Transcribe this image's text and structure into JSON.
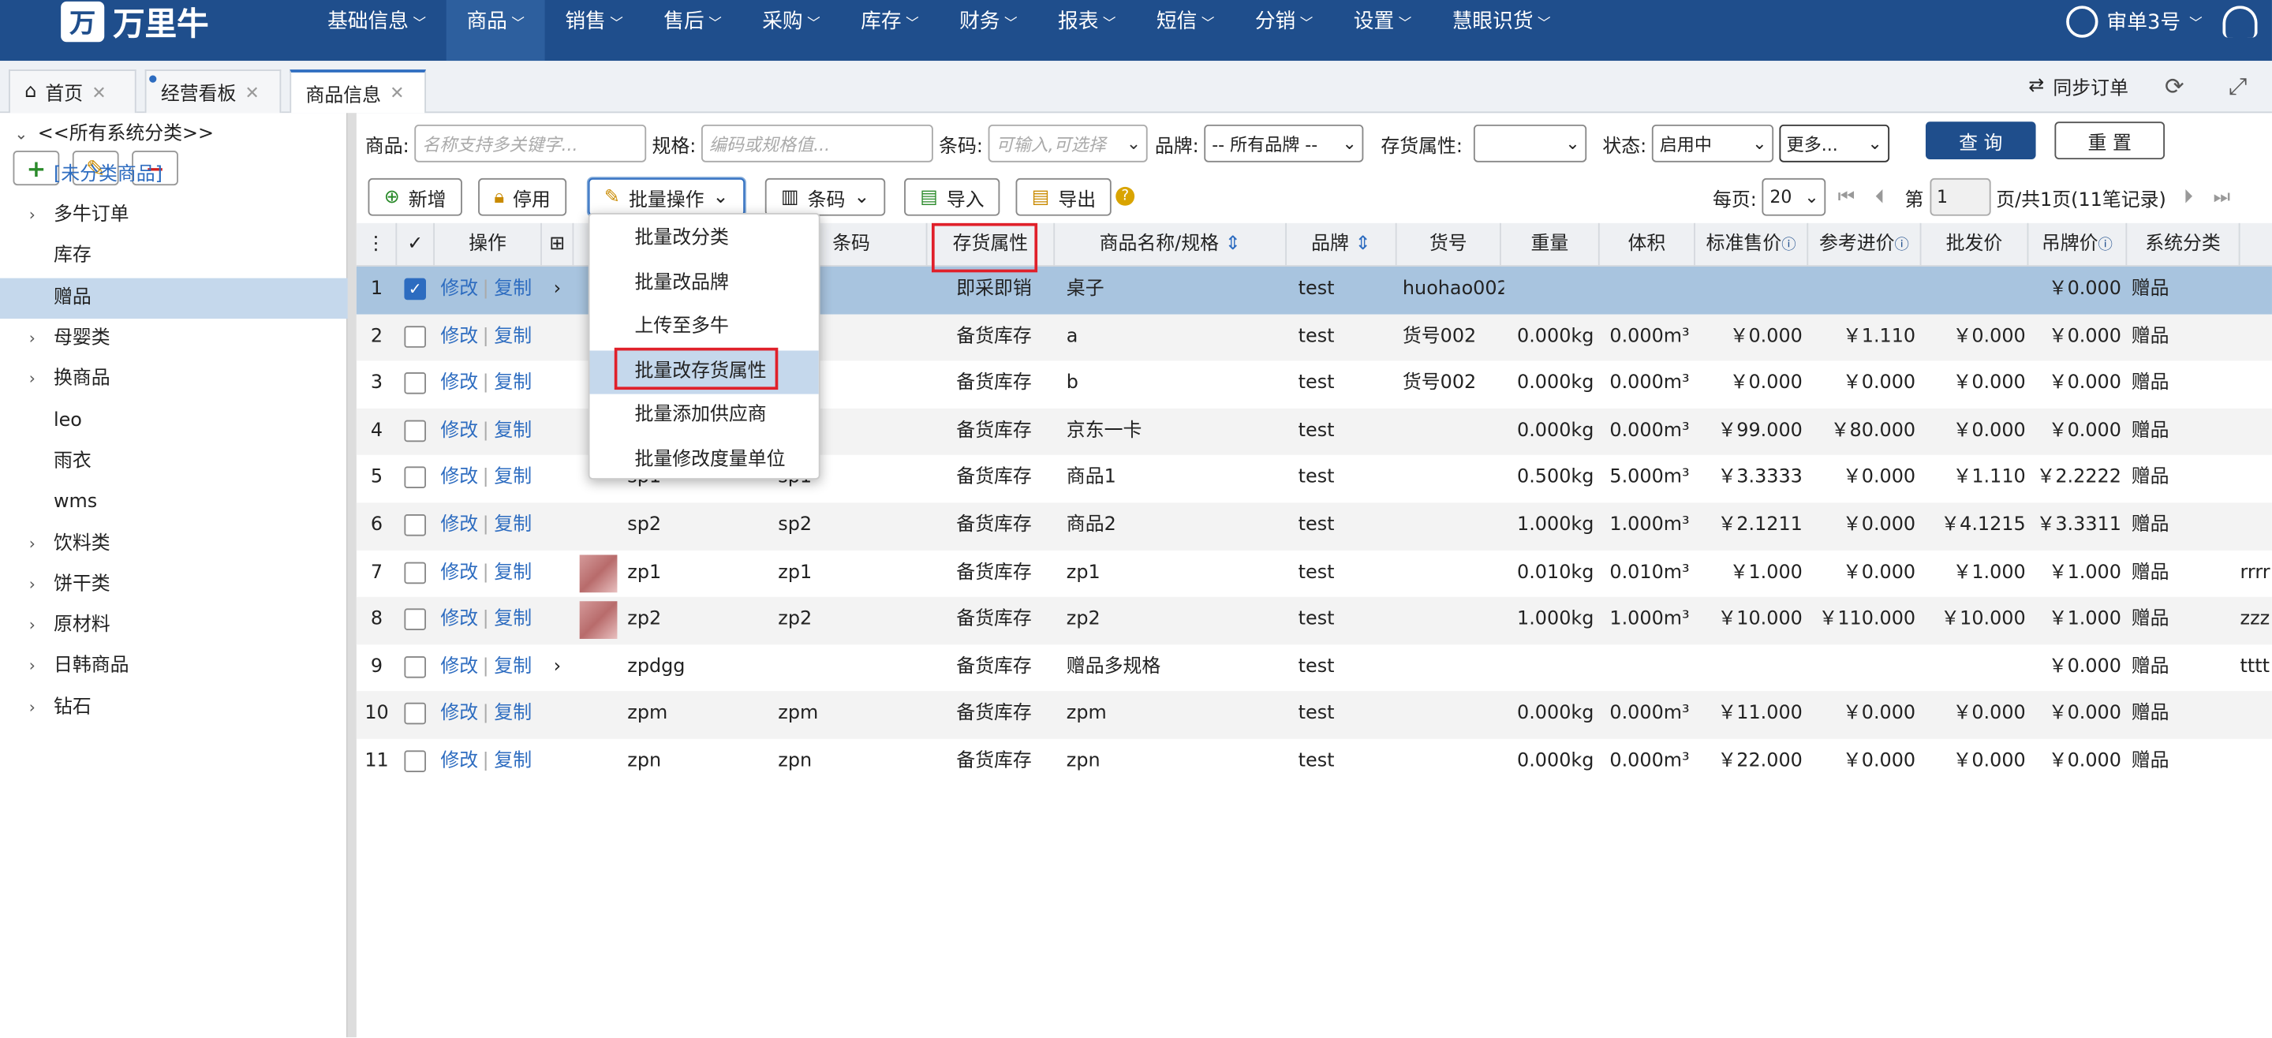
{
  "brand": {
    "logo_mark": "万",
    "name": "万里牛"
  },
  "nav": [
    "基础信息",
    "商品",
    "销售",
    "售后",
    "采购",
    "库存",
    "财务",
    "报表",
    "短信",
    "分销",
    "设置",
    "慧眼识货"
  ],
  "user": {
    "name": "审单3号"
  },
  "tabs": [
    {
      "label": "首页"
    },
    {
      "label": "经营看板"
    },
    {
      "label": "商品信息"
    }
  ],
  "tab_tools": {
    "sync_label": "同步订单"
  },
  "sidebar": {
    "buttons": [
      "+",
      "✎",
      "−"
    ],
    "items": [
      "<<所有系统分类>>",
      "[未分类商品]",
      "多牛订单",
      "库存",
      "赠品",
      "母婴类",
      "换商品",
      "leo",
      "雨衣",
      "wms",
      "饮料类",
      "饼干类",
      "原材料",
      "日韩商品",
      "钻石"
    ]
  },
  "filters": {
    "product_label": "商品:",
    "product_placeholder": "名称支持多关键字...",
    "spec_label": "规格:",
    "spec_placeholder": "编码或规格值...",
    "barcode_label": "条码:",
    "barcode_placeholder": "可输入,可选择",
    "brand_label": "品牌:",
    "brand_value": "-- 所有品牌 --",
    "stock_attr_label": "存货属性:",
    "stock_attr_value": "",
    "status_label": "状态:",
    "status_value": "启用中",
    "more_label": "更多...",
    "query_label": "查 询",
    "reset_label": "重 置"
  },
  "toolbar": {
    "add": "新增",
    "disable": "停用",
    "batch": "批量操作",
    "barcode": "条码",
    "import": "导入",
    "export": "导出"
  },
  "pager": {
    "per_page_label": "每页:",
    "per_page": "20",
    "page_prefix": "第",
    "page_value": "1",
    "page_suffix": "页/共1页(11笔记录)"
  },
  "columns": [
    "操作",
    "条码",
    "存货属性",
    "商品名称/规格",
    "品牌",
    "货号",
    "重量",
    "体积",
    "标准售价",
    "参考进价",
    "批发价",
    "吊牌价",
    "系统分类"
  ],
  "row_actions": {
    "edit": "修改",
    "copy": "复制",
    "sep": "|"
  },
  "rows": [
    {
      "n": "1",
      "code": "",
      "spec": "",
      "attr": "即采即销",
      "name": "桌子",
      "brand": "test",
      "sku": "huohao002",
      "weight": "",
      "vol": "",
      "std": "",
      "ref": "",
      "whole": "",
      "tag": "￥0.000",
      "cat": "赠品",
      "extra": "",
      "checked": true,
      "expand": true
    },
    {
      "n": "2",
      "code": "",
      "spec": "",
      "attr": "备货库存",
      "name": "a",
      "brand": "test",
      "sku": "货号002",
      "weight": "0.000kg",
      "vol": "0.000m³",
      "std": "￥0.000",
      "ref": "￥1.110",
      "whole": "￥0.000",
      "tag": "￥0.000",
      "cat": "赠品",
      "extra": ""
    },
    {
      "n": "3",
      "code": "",
      "spec": "",
      "attr": "备货库存",
      "name": "b",
      "brand": "test",
      "sku": "货号002",
      "weight": "0.000kg",
      "vol": "0.000m³",
      "std": "￥0.000",
      "ref": "￥0.000",
      "whole": "￥0.000",
      "tag": "￥0.000",
      "cat": "赠品",
      "extra": ""
    },
    {
      "n": "4",
      "code": "",
      "spec": "",
      "attr": "备货库存",
      "name": "京东一卡",
      "brand": "test",
      "sku": "",
      "weight": "0.000kg",
      "vol": "0.000m³",
      "std": "￥99.000",
      "ref": "￥80.000",
      "whole": "￥0.000",
      "tag": "￥0.000",
      "cat": "赠品",
      "extra": ""
    },
    {
      "n": "5",
      "code": "sp1",
      "spec": "sp1",
      "attr": "备货库存",
      "name": "商品1",
      "brand": "test",
      "sku": "",
      "weight": "0.500kg",
      "vol": "5.000m³",
      "std": "￥3.3333",
      "ref": "￥0.000",
      "whole": "￥1.110",
      "tag": "￥2.2222",
      "cat": "赠品",
      "extra": ""
    },
    {
      "n": "6",
      "code": "sp2",
      "spec": "sp2",
      "attr": "备货库存",
      "name": "商品2",
      "brand": "test",
      "sku": "",
      "weight": "1.000kg",
      "vol": "1.000m³",
      "std": "￥2.1211",
      "ref": "￥0.000",
      "whole": "￥4.1215",
      "tag": "￥3.3311",
      "cat": "赠品",
      "extra": ""
    },
    {
      "n": "7",
      "code": "zp1",
      "spec": "zp1",
      "attr": "备货库存",
      "name": "zp1",
      "brand": "test",
      "sku": "",
      "weight": "0.010kg",
      "vol": "0.010m³",
      "std": "￥1.000",
      "ref": "￥0.000",
      "whole": "￥1.000",
      "tag": "￥1.000",
      "cat": "赠品",
      "extra": "rrrr",
      "thumb": true
    },
    {
      "n": "8",
      "code": "zp2",
      "spec": "zp2",
      "attr": "备货库存",
      "name": "zp2",
      "brand": "test",
      "sku": "",
      "weight": "1.000kg",
      "vol": "1.000m³",
      "std": "￥10.000",
      "ref": "￥110.000",
      "whole": "￥10.000",
      "tag": "￥1.000",
      "cat": "赠品",
      "extra": "zzz",
      "thumb": true
    },
    {
      "n": "9",
      "code": "zpdgg",
      "spec": "",
      "attr": "备货库存",
      "name": "赠品多规格",
      "brand": "test",
      "sku": "",
      "weight": "",
      "vol": "",
      "std": "",
      "ref": "",
      "whole": "",
      "tag": "￥0.000",
      "cat": "赠品",
      "extra": "tttt",
      "expand": true
    },
    {
      "n": "10",
      "code": "zpm",
      "spec": "zpm",
      "attr": "备货库存",
      "name": "zpm",
      "brand": "test",
      "sku": "",
      "weight": "0.000kg",
      "vol": "0.000m³",
      "std": "￥11.000",
      "ref": "￥0.000",
      "whole": "￥0.000",
      "tag": "￥0.000",
      "cat": "赠品",
      "extra": ""
    },
    {
      "n": "11",
      "code": "zpn",
      "spec": "zpn",
      "attr": "备货库存",
      "name": "zpn",
      "brand": "test",
      "sku": "",
      "weight": "0.000kg",
      "vol": "0.000m³",
      "std": "￥22.000",
      "ref": "￥0.000",
      "whole": "￥0.000",
      "tag": "￥0.000",
      "cat": "赠品",
      "extra": ""
    }
  ],
  "batch_menu": [
    "批量改分类",
    "批量改品牌",
    "上传至多牛",
    "批量改存货属性",
    "批量添加供应商",
    "批量修改度量单位"
  ],
  "colors": {
    "nav_bg": "#1f4e8c",
    "link": "#2d6cc0",
    "highlight": "#e0202a",
    "selected_row": "#a8c4df"
  }
}
